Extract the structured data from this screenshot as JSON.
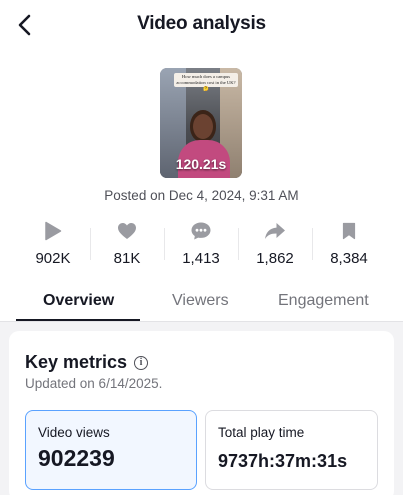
{
  "header": {
    "title": "Video analysis"
  },
  "video": {
    "duration": "120.21s",
    "thumbnail_caption": "How much does a campus accommodation cost in the UK? 🤔",
    "posted": "Posted on Dec 4, 2024, 9:31 AM"
  },
  "stats": [
    {
      "icon": "play-icon",
      "value": "902K"
    },
    {
      "icon": "heart-icon",
      "value": "81K"
    },
    {
      "icon": "comment-icon",
      "value": "1,413"
    },
    {
      "icon": "share-icon",
      "value": "1,862"
    },
    {
      "icon": "bookmark-icon",
      "value": "8,384"
    }
  ],
  "tabs": [
    {
      "label": "Overview",
      "active": true
    },
    {
      "label": "Viewers",
      "active": false
    },
    {
      "label": "Engagement",
      "active": false
    }
  ],
  "key_metrics": {
    "title": "Key metrics",
    "updated": "Updated on 6/14/2025.",
    "metrics": [
      {
        "label": "Video views",
        "value": "902239",
        "selected": true
      },
      {
        "label": "Total play time",
        "value": "9737h:37m:31s",
        "selected": false
      }
    ]
  },
  "colors": {
    "text_primary": "#161823",
    "text_secondary": "#73747b",
    "icon_gray": "#9a9ba1",
    "selected_border": "#5aa2ff",
    "selected_bg": "#f2f7ff",
    "panel_bg": "#f3f3f5"
  }
}
